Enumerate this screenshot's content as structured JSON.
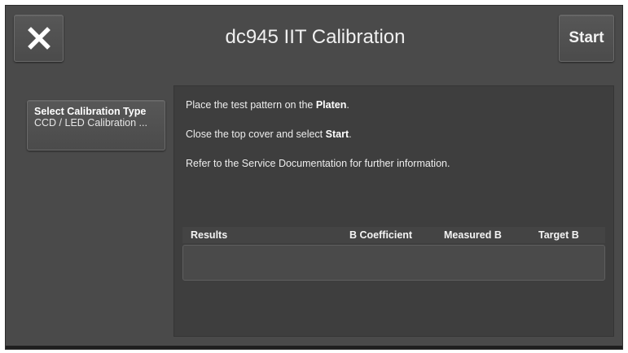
{
  "header": {
    "title": "dc945 IIT Calibration",
    "close_icon": "close-x-icon",
    "start_label": "Start"
  },
  "calibration_type": {
    "label": "Select Calibration Type",
    "value": "CCD / LED Calibration ..."
  },
  "instructions": {
    "line1_prefix": "Place the test pattern on the ",
    "line1_bold": "Platen",
    "line1_suffix": ".",
    "line2_prefix": "Close the top cover and select ",
    "line2_bold": "Start",
    "line2_suffix": ".",
    "line3": "Refer to the Service Documentation for further information."
  },
  "results_table": {
    "columns": [
      "Results",
      "B Coefficient",
      "Measured B",
      "Target B"
    ],
    "rows": []
  },
  "colors": {
    "background": "#4a4a4a",
    "panel": "#3e3e3e",
    "text": "#f0f0f0"
  }
}
